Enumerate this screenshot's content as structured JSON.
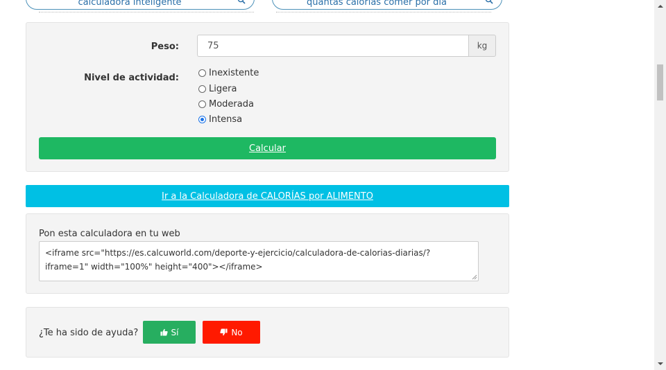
{
  "top_search": {
    "left_pill_text": "calculadora inteligente",
    "right_pill_text": "quantas calorias comer por dia"
  },
  "form": {
    "weight_label": "Peso:",
    "weight_value": "75",
    "weight_unit": "kg",
    "activity_label": "Nivel de actividad:",
    "activity_options": [
      {
        "label": "Inexistente",
        "selected": false
      },
      {
        "label": "Ligera",
        "selected": false
      },
      {
        "label": "Moderada",
        "selected": false
      },
      {
        "label": "Intensa",
        "selected": true
      }
    ],
    "calculate_label": "Calcular"
  },
  "food_calculator_link": "Ir a la Calculadora de CALORÍAS por ALIMENTO",
  "embed": {
    "label": "Pon esta calculadora en tu web",
    "code": "<iframe src=\"https://es.calcuworld.com/deporte-y-ejercicio/calculadora-de-calorias-diarias/?iframe=1\" width=\"100%\" height=\"400\"></iframe>"
  },
  "feedback": {
    "question": "¿Te ha sido de ayuda?",
    "yes_label": "Sí",
    "no_label": "No"
  },
  "colors": {
    "calculate_button": "#1eb862",
    "food_link_button": "#00c0e4",
    "yes_button": "#27ae60",
    "no_button": "#ff1a00"
  }
}
